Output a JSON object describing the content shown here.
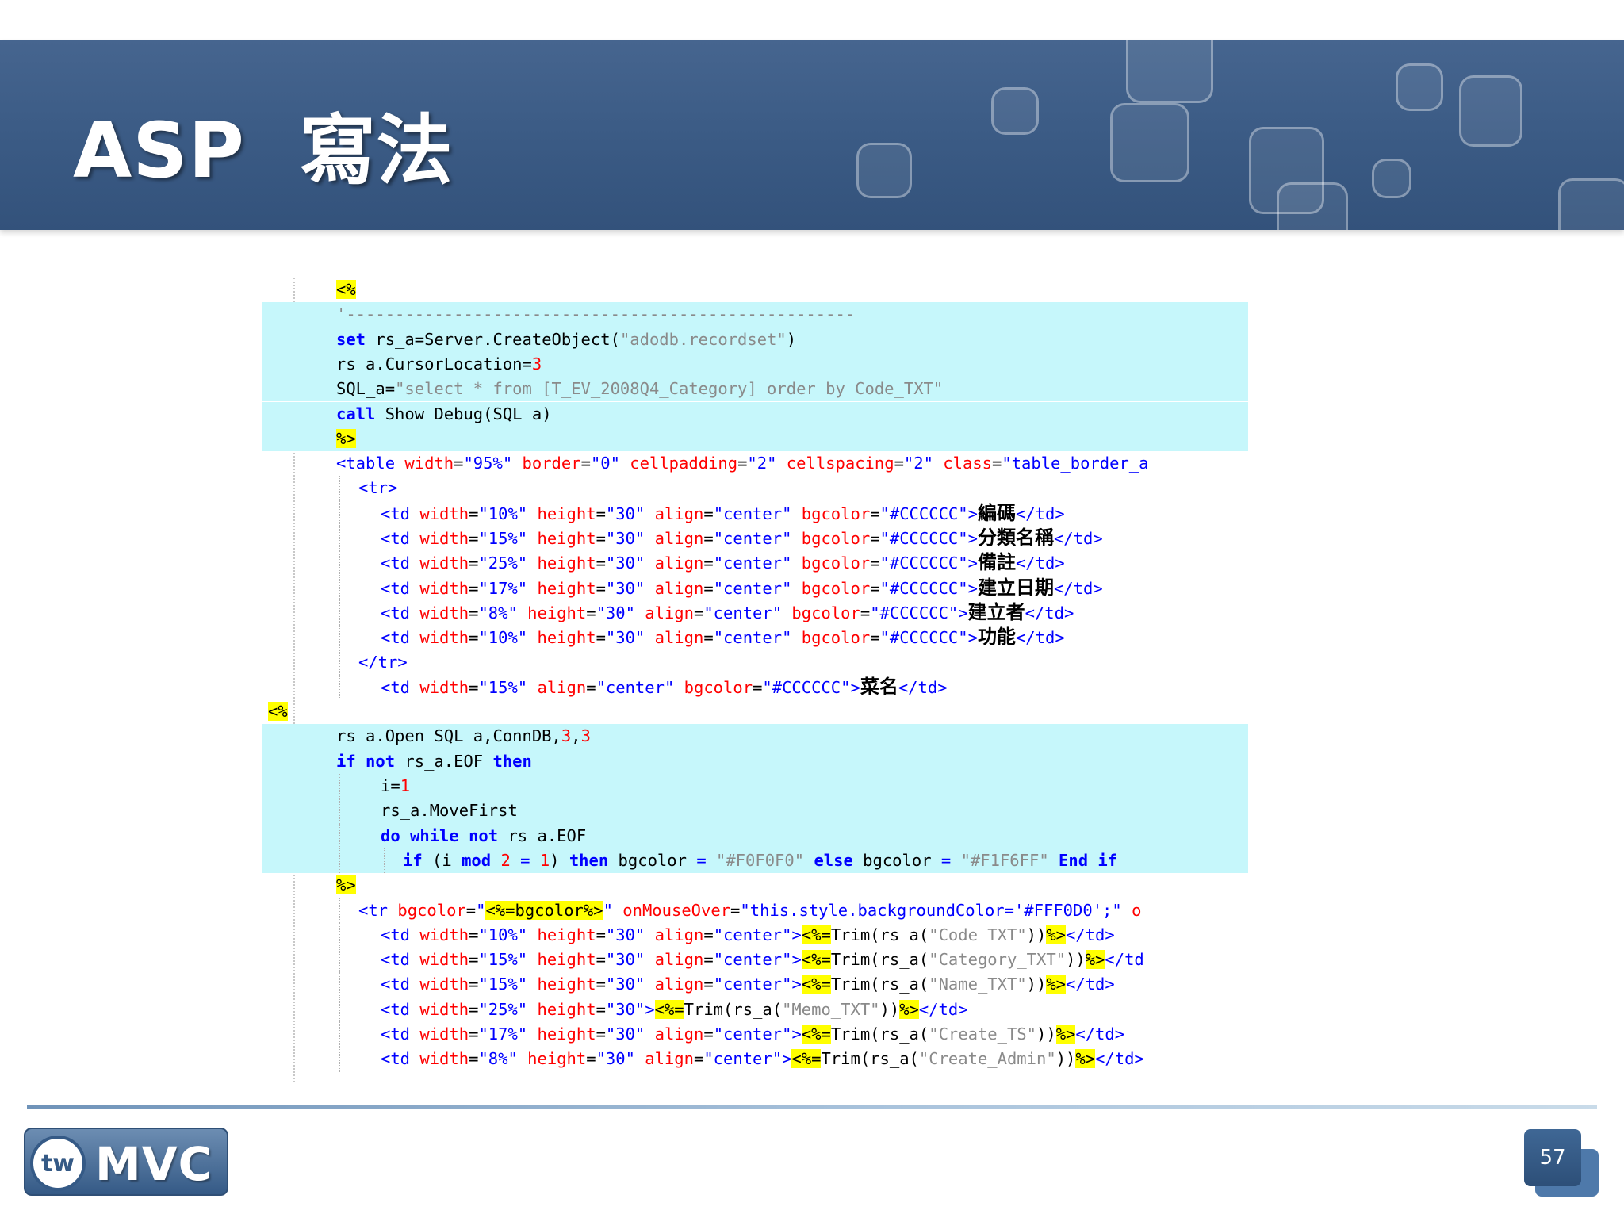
{
  "slide": {
    "title": "ASP  寫法",
    "page_number": "57",
    "logo": {
      "prefix": "tw",
      "text": "MVC"
    }
  },
  "colors": {
    "header": "#3c5c86",
    "code_highlight_bg": "#c6f7fb",
    "asp_delimiter_bg": "#ffff00"
  },
  "code_lines": [
    {
      "indent": 0,
      "bg": false,
      "parts": [
        {
          "t": "<%",
          "c": "hl"
        }
      ]
    },
    {
      "indent": 0,
      "bg": true,
      "parts": [
        {
          "t": "'----------------------------------------------------",
          "c": "str"
        }
      ]
    },
    {
      "indent": 0,
      "bg": true,
      "parts": [
        {
          "t": "set",
          "c": "kw"
        },
        {
          "t": " rs_a=Server.CreateObject("
        },
        {
          "t": "\"adodb.recordset\"",
          "c": "str"
        },
        {
          "t": ")"
        }
      ]
    },
    {
      "indent": 0,
      "bg": true,
      "parts": [
        {
          "t": "rs_a.CursorLocation="
        },
        {
          "t": "3",
          "c": "num"
        }
      ]
    },
    {
      "indent": 0,
      "bg": true,
      "parts": [
        {
          "t": "SQL_a="
        },
        {
          "t": "\"select * from [T_EV_2008Q4_Category] order by Code_TXT\"",
          "c": "str"
        }
      ]
    },
    {
      "indent": 0,
      "bg": true,
      "parts": [
        {
          "t": "call",
          "c": "kw"
        },
        {
          "t": " Show_Debug(SQL_a)"
        }
      ]
    },
    {
      "indent": 0,
      "bg": true,
      "parts": [
        {
          "t": "%>",
          "c": "hl"
        }
      ]
    },
    {
      "indent": 0,
      "bg": false,
      "parts": [
        {
          "t": "<table",
          "c": "tag"
        },
        {
          "t": " width",
          "c": "atr"
        },
        {
          "t": "="
        },
        {
          "t": "\"95%\"",
          "c": "val"
        },
        {
          "t": " border",
          "c": "atr"
        },
        {
          "t": "="
        },
        {
          "t": "\"0\"",
          "c": "val"
        },
        {
          "t": " cellpadding",
          "c": "atr"
        },
        {
          "t": "="
        },
        {
          "t": "\"2\"",
          "c": "val"
        },
        {
          "t": " cellspacing",
          "c": "atr"
        },
        {
          "t": "="
        },
        {
          "t": "\"2\"",
          "c": "val"
        },
        {
          "t": " class",
          "c": "atr"
        },
        {
          "t": "="
        },
        {
          "t": "\"table_border_a",
          "c": "val"
        }
      ]
    },
    {
      "indent": 1,
      "bg": false,
      "parts": [
        {
          "t": "<tr>",
          "c": "tag"
        }
      ]
    },
    {
      "indent": 2,
      "bg": false,
      "parts": [
        {
          "t": "<td",
          "c": "tag"
        },
        {
          "t": " width",
          "c": "atr"
        },
        {
          "t": "="
        },
        {
          "t": "\"10%\"",
          "c": "val"
        },
        {
          "t": " height",
          "c": "atr"
        },
        {
          "t": "="
        },
        {
          "t": "\"30\"",
          "c": "val"
        },
        {
          "t": " align",
          "c": "atr"
        },
        {
          "t": "="
        },
        {
          "t": "\"center\"",
          "c": "val"
        },
        {
          "t": " bgcolor",
          "c": "atr"
        },
        {
          "t": "="
        },
        {
          "t": "\"#CCCCCC\"",
          "c": "val"
        },
        {
          "t": ">",
          "c": "tag"
        },
        {
          "t": "編碼",
          "c": "zh"
        },
        {
          "t": "</td>",
          "c": "tag"
        }
      ]
    },
    {
      "indent": 2,
      "bg": false,
      "parts": [
        {
          "t": "<td",
          "c": "tag"
        },
        {
          "t": " width",
          "c": "atr"
        },
        {
          "t": "="
        },
        {
          "t": "\"15%\"",
          "c": "val"
        },
        {
          "t": " height",
          "c": "atr"
        },
        {
          "t": "="
        },
        {
          "t": "\"30\"",
          "c": "val"
        },
        {
          "t": " align",
          "c": "atr"
        },
        {
          "t": "="
        },
        {
          "t": "\"center\"",
          "c": "val"
        },
        {
          "t": " bgcolor",
          "c": "atr"
        },
        {
          "t": "="
        },
        {
          "t": "\"#CCCCCC\"",
          "c": "val"
        },
        {
          "t": ">",
          "c": "tag"
        },
        {
          "t": "分類名稱",
          "c": "zh"
        },
        {
          "t": "</td>",
          "c": "tag"
        }
      ]
    },
    {
      "indent": 2,
      "bg": false,
      "parts": [
        {
          "t": "<td",
          "c": "tag"
        },
        {
          "t": " width",
          "c": "atr"
        },
        {
          "t": "="
        },
        {
          "t": "\"25%\"",
          "c": "val"
        },
        {
          "t": " height",
          "c": "atr"
        },
        {
          "t": "="
        },
        {
          "t": "\"30\"",
          "c": "val"
        },
        {
          "t": " align",
          "c": "atr"
        },
        {
          "t": "="
        },
        {
          "t": "\"center\"",
          "c": "val"
        },
        {
          "t": " bgcolor",
          "c": "atr"
        },
        {
          "t": "="
        },
        {
          "t": "\"#CCCCCC\"",
          "c": "val"
        },
        {
          "t": ">",
          "c": "tag"
        },
        {
          "t": "備註",
          "c": "zh"
        },
        {
          "t": "</td>",
          "c": "tag"
        }
      ]
    },
    {
      "indent": 2,
      "bg": false,
      "parts": [
        {
          "t": "<td",
          "c": "tag"
        },
        {
          "t": " width",
          "c": "atr"
        },
        {
          "t": "="
        },
        {
          "t": "\"17%\"",
          "c": "val"
        },
        {
          "t": " height",
          "c": "atr"
        },
        {
          "t": "="
        },
        {
          "t": "\"30\"",
          "c": "val"
        },
        {
          "t": " align",
          "c": "atr"
        },
        {
          "t": "="
        },
        {
          "t": "\"center\"",
          "c": "val"
        },
        {
          "t": " bgcolor",
          "c": "atr"
        },
        {
          "t": "="
        },
        {
          "t": "\"#CCCCCC\"",
          "c": "val"
        },
        {
          "t": ">",
          "c": "tag"
        },
        {
          "t": "建立日期",
          "c": "zh"
        },
        {
          "t": "</td>",
          "c": "tag"
        }
      ]
    },
    {
      "indent": 2,
      "bg": false,
      "parts": [
        {
          "t": "<td",
          "c": "tag"
        },
        {
          "t": " width",
          "c": "atr"
        },
        {
          "t": "="
        },
        {
          "t": "\"8%\"",
          "c": "val"
        },
        {
          "t": " height",
          "c": "atr"
        },
        {
          "t": "="
        },
        {
          "t": "\"30\"",
          "c": "val"
        },
        {
          "t": " align",
          "c": "atr"
        },
        {
          "t": "="
        },
        {
          "t": "\"center\"",
          "c": "val"
        },
        {
          "t": " bgcolor",
          "c": "atr"
        },
        {
          "t": "="
        },
        {
          "t": "\"#CCCCCC\"",
          "c": "val"
        },
        {
          "t": ">",
          "c": "tag"
        },
        {
          "t": "建立者",
          "c": "zh"
        },
        {
          "t": "</td>",
          "c": "tag"
        }
      ]
    },
    {
      "indent": 2,
      "bg": false,
      "parts": [
        {
          "t": "<td",
          "c": "tag"
        },
        {
          "t": " width",
          "c": "atr"
        },
        {
          "t": "="
        },
        {
          "t": "\"10%\"",
          "c": "val"
        },
        {
          "t": " height",
          "c": "atr"
        },
        {
          "t": "="
        },
        {
          "t": "\"30\"",
          "c": "val"
        },
        {
          "t": " align",
          "c": "atr"
        },
        {
          "t": "="
        },
        {
          "t": "\"center\"",
          "c": "val"
        },
        {
          "t": " bgcolor",
          "c": "atr"
        },
        {
          "t": "="
        },
        {
          "t": "\"#CCCCCC\"",
          "c": "val"
        },
        {
          "t": ">",
          "c": "tag"
        },
        {
          "t": "功能",
          "c": "zh"
        },
        {
          "t": "</td>",
          "c": "tag"
        }
      ]
    },
    {
      "indent": 1,
      "bg": false,
      "parts": [
        {
          "t": "</tr>",
          "c": "tag"
        }
      ]
    },
    {
      "indent": 2,
      "bg": false,
      "parts": [
        {
          "t": "<td",
          "c": "tag"
        },
        {
          "t": " width",
          "c": "atr"
        },
        {
          "t": "="
        },
        {
          "t": "\"15%\"",
          "c": "val"
        },
        {
          "t": " align",
          "c": "atr"
        },
        {
          "t": "="
        },
        {
          "t": "\"center\"",
          "c": "val"
        },
        {
          "t": " bgcolor",
          "c": "atr"
        },
        {
          "t": "="
        },
        {
          "t": "\"#CCCCCC\"",
          "c": "val"
        },
        {
          "t": ">",
          "c": "tag"
        },
        {
          "t": "菜名",
          "c": "zh"
        },
        {
          "t": "</td>",
          "c": "tag"
        }
      ]
    },
    {
      "indent": -1,
      "bg": false,
      "parts": [
        {
          "t": "<%",
          "c": "hl"
        }
      ]
    },
    {
      "indent": 0,
      "bg": true,
      "parts": [
        {
          "t": "rs_a.Open SQL_a,ConnDB,"
        },
        {
          "t": "3",
          "c": "num"
        },
        {
          "t": ","
        },
        {
          "t": "3",
          "c": "num"
        }
      ]
    },
    {
      "indent": 0,
      "bg": true,
      "parts": [
        {
          "t": "if not",
          "c": "kw"
        },
        {
          "t": " rs_a.EOF "
        },
        {
          "t": "then",
          "c": "kw"
        }
      ]
    },
    {
      "indent": 2,
      "bg": true,
      "parts": [
        {
          "t": "i="
        },
        {
          "t": "1",
          "c": "num"
        }
      ]
    },
    {
      "indent": 2,
      "bg": true,
      "parts": [
        {
          "t": "rs_a.MoveFirst"
        }
      ]
    },
    {
      "indent": 2,
      "bg": true,
      "parts": [
        {
          "t": "do while not",
          "c": "kw"
        },
        {
          "t": " rs_a.EOF"
        }
      ]
    },
    {
      "indent": 3,
      "bg": true,
      "parts": [
        {
          "t": "if",
          "c": "kw"
        },
        {
          "t": " (i "
        },
        {
          "t": "mod",
          "c": "kw"
        },
        {
          "t": " "
        },
        {
          "t": "2",
          "c": "num"
        },
        {
          "t": " = ",
          "c": "op"
        },
        {
          "t": "1",
          "c": "num"
        },
        {
          "t": ") "
        },
        {
          "t": "then",
          "c": "kw"
        },
        {
          "t": " bgcolor "
        },
        {
          "t": "=",
          "c": "op"
        },
        {
          "t": " "
        },
        {
          "t": "\"#F0F0F0\"",
          "c": "str"
        },
        {
          "t": " "
        },
        {
          "t": "else",
          "c": "kw"
        },
        {
          "t": " bgcolor "
        },
        {
          "t": "=",
          "c": "op"
        },
        {
          "t": " "
        },
        {
          "t": "\"#F1F6FF\"",
          "c": "str"
        },
        {
          "t": " "
        },
        {
          "t": "End if",
          "c": "kw"
        }
      ]
    },
    {
      "indent": 0,
      "bg": false,
      "parts": [
        {
          "t": "%>",
          "c": "hl"
        }
      ]
    },
    {
      "indent": 1,
      "bg": false,
      "parts": [
        {
          "t": "<tr",
          "c": "tag"
        },
        {
          "t": " bgcolor",
          "c": "atr"
        },
        {
          "t": "="
        },
        {
          "t": "\"",
          "c": "val"
        },
        {
          "t": "<%=",
          "c": "hl"
        },
        {
          "t": "bgcolor",
          "c": "hl"
        },
        {
          "t": "%>",
          "c": "hl"
        },
        {
          "t": "\"",
          "c": "val"
        },
        {
          "t": " onMouseOver",
          "c": "atr"
        },
        {
          "t": "="
        },
        {
          "t": "\"this.style.backgroundColor='#FFF0D0';\"",
          "c": "val"
        },
        {
          "t": " o",
          "c": "atr"
        }
      ]
    },
    {
      "indent": 2,
      "bg": false,
      "parts": [
        {
          "t": "<td",
          "c": "tag"
        },
        {
          "t": " width",
          "c": "atr"
        },
        {
          "t": "="
        },
        {
          "t": "\"10%\"",
          "c": "val"
        },
        {
          "t": " height",
          "c": "atr"
        },
        {
          "t": "="
        },
        {
          "t": "\"30\"",
          "c": "val"
        },
        {
          "t": " align",
          "c": "atr"
        },
        {
          "t": "="
        },
        {
          "t": "\"center\"",
          "c": "val"
        },
        {
          "t": ">",
          "c": "tag"
        },
        {
          "t": "<%=",
          "c": "hl"
        },
        {
          "t": "Trim(rs_a("
        },
        {
          "t": "\"Code_TXT\"",
          "c": "str"
        },
        {
          "t": "))"
        },
        {
          "t": "%>",
          "c": "hl"
        },
        {
          "t": "</td>",
          "c": "tag"
        }
      ]
    },
    {
      "indent": 2,
      "bg": false,
      "parts": [
        {
          "t": "<td",
          "c": "tag"
        },
        {
          "t": " width",
          "c": "atr"
        },
        {
          "t": "="
        },
        {
          "t": "\"15%\"",
          "c": "val"
        },
        {
          "t": " height",
          "c": "atr"
        },
        {
          "t": "="
        },
        {
          "t": "\"30\"",
          "c": "val"
        },
        {
          "t": " align",
          "c": "atr"
        },
        {
          "t": "="
        },
        {
          "t": "\"center\"",
          "c": "val"
        },
        {
          "t": ">",
          "c": "tag"
        },
        {
          "t": "<%=",
          "c": "hl"
        },
        {
          "t": "Trim(rs_a("
        },
        {
          "t": "\"Category_TXT\"",
          "c": "str"
        },
        {
          "t": "))"
        },
        {
          "t": "%>",
          "c": "hl"
        },
        {
          "t": "</td",
          "c": "tag"
        }
      ]
    },
    {
      "indent": 2,
      "bg": false,
      "parts": [
        {
          "t": "<td",
          "c": "tag"
        },
        {
          "t": " width",
          "c": "atr"
        },
        {
          "t": "="
        },
        {
          "t": "\"15%\"",
          "c": "val"
        },
        {
          "t": " height",
          "c": "atr"
        },
        {
          "t": "="
        },
        {
          "t": "\"30\"",
          "c": "val"
        },
        {
          "t": " align",
          "c": "atr"
        },
        {
          "t": "="
        },
        {
          "t": "\"center\"",
          "c": "val"
        },
        {
          "t": ">",
          "c": "tag"
        },
        {
          "t": "<%=",
          "c": "hl"
        },
        {
          "t": "Trim(rs_a("
        },
        {
          "t": "\"Name_TXT\"",
          "c": "str"
        },
        {
          "t": "))"
        },
        {
          "t": "%>",
          "c": "hl"
        },
        {
          "t": "</td>",
          "c": "tag"
        }
      ]
    },
    {
      "indent": 2,
      "bg": false,
      "parts": [
        {
          "t": "<td",
          "c": "tag"
        },
        {
          "t": " width",
          "c": "atr"
        },
        {
          "t": "="
        },
        {
          "t": "\"25%\"",
          "c": "val"
        },
        {
          "t": " height",
          "c": "atr"
        },
        {
          "t": "="
        },
        {
          "t": "\"30\"",
          "c": "val"
        },
        {
          "t": ">",
          "c": "tag"
        },
        {
          "t": "<%=",
          "c": "hl"
        },
        {
          "t": "Trim(rs_a("
        },
        {
          "t": "\"Memo_TXT\"",
          "c": "str"
        },
        {
          "t": "))"
        },
        {
          "t": "%>",
          "c": "hl"
        },
        {
          "t": "</td>",
          "c": "tag"
        }
      ]
    },
    {
      "indent": 2,
      "bg": false,
      "parts": [
        {
          "t": "<td",
          "c": "tag"
        },
        {
          "t": " width",
          "c": "atr"
        },
        {
          "t": "="
        },
        {
          "t": "\"17%\"",
          "c": "val"
        },
        {
          "t": " height",
          "c": "atr"
        },
        {
          "t": "="
        },
        {
          "t": "\"30\"",
          "c": "val"
        },
        {
          "t": " align",
          "c": "atr"
        },
        {
          "t": "="
        },
        {
          "t": "\"center\"",
          "c": "val"
        },
        {
          "t": ">",
          "c": "tag"
        },
        {
          "t": "<%=",
          "c": "hl"
        },
        {
          "t": "Trim(rs_a("
        },
        {
          "t": "\"Create_TS\"",
          "c": "str"
        },
        {
          "t": "))"
        },
        {
          "t": "%>",
          "c": "hl"
        },
        {
          "t": "</td>",
          "c": "tag"
        }
      ]
    },
    {
      "indent": 2,
      "bg": false,
      "parts": [
        {
          "t": "<td",
          "c": "tag"
        },
        {
          "t": " width",
          "c": "atr"
        },
        {
          "t": "="
        },
        {
          "t": "\"8%\"",
          "c": "val"
        },
        {
          "t": " height",
          "c": "atr"
        },
        {
          "t": "="
        },
        {
          "t": "\"30\"",
          "c": "val"
        },
        {
          "t": " align",
          "c": "atr"
        },
        {
          "t": "="
        },
        {
          "t": "\"center\"",
          "c": "val"
        },
        {
          "t": ">",
          "c": "tag"
        },
        {
          "t": "<%=",
          "c": "hl"
        },
        {
          "t": "Trim(rs_a("
        },
        {
          "t": "\"Create_Admin\"",
          "c": "str"
        },
        {
          "t": "))"
        },
        {
          "t": "%>",
          "c": "hl"
        },
        {
          "t": "</td>",
          "c": "tag"
        }
      ]
    }
  ]
}
